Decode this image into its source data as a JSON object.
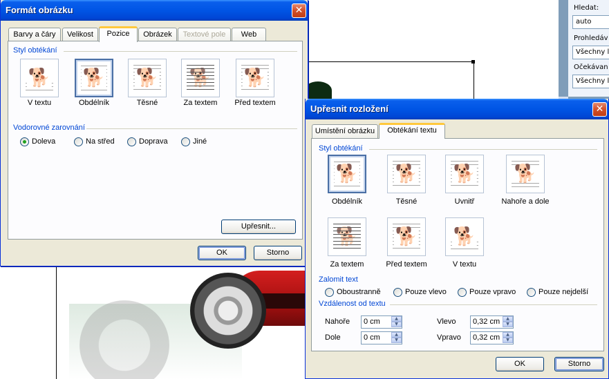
{
  "task_pane": {
    "search_label": "Hledat:",
    "search_value": "auto",
    "search_in_label": "Prohledáv",
    "search_in_value": "Všechny l",
    "expected_label": "Očekávan",
    "expected_value": "Všechny l"
  },
  "format_dialog": {
    "title": "Formát obrázku",
    "tabs": [
      {
        "label": "Barvy a čáry",
        "state": "normal"
      },
      {
        "label": "Velikost",
        "state": "normal"
      },
      {
        "label": "Pozice",
        "state": "active"
      },
      {
        "label": "Obrázek",
        "state": "normal"
      },
      {
        "label": "Textové pole",
        "state": "disabled"
      },
      {
        "label": "Web",
        "state": "normal"
      }
    ],
    "wrap_group_label": "Styl obtékání",
    "wrap_options": [
      {
        "label": "V textu",
        "icon": "inline-icon",
        "selected": false
      },
      {
        "label": "Obdélník",
        "icon": "square-wrap-icon",
        "selected": true
      },
      {
        "label": "Těsné",
        "icon": "tight-wrap-icon",
        "selected": false
      },
      {
        "label": "Za textem",
        "icon": "behind-text-icon",
        "selected": false
      },
      {
        "label": "Před textem",
        "icon": "in-front-text-icon",
        "selected": false
      }
    ],
    "align_group_label": "Vodorovné zarovnání",
    "align_options": [
      {
        "label": "Doleva",
        "checked": true
      },
      {
        "label": "Na střed",
        "checked": false
      },
      {
        "label": "Doprava",
        "checked": false
      },
      {
        "label": "Jiné",
        "checked": false
      }
    ],
    "advanced_button": "Upřesnit...",
    "ok_button": "OK",
    "cancel_button": "Storno"
  },
  "advanced_dialog": {
    "title": "Upřesnit rozložení",
    "tabs": [
      {
        "label": "Umístění obrázku",
        "state": "normal"
      },
      {
        "label": "Obtékání textu",
        "state": "active"
      }
    ],
    "wrap_group_label": "Styl obtékání",
    "wrap_options": [
      {
        "label": "Obdélník",
        "icon": "square-wrap-icon",
        "selected": true
      },
      {
        "label": "Těsné",
        "icon": "tight-wrap-icon",
        "selected": false
      },
      {
        "label": "Uvnitř",
        "icon": "through-wrap-icon",
        "selected": false
      },
      {
        "label": "Nahoře a dole",
        "icon": "top-bottom-icon",
        "selected": false
      },
      {
        "label": "Za textem",
        "icon": "behind-text-icon",
        "selected": false
      },
      {
        "label": "Před textem",
        "icon": "in-front-text-icon",
        "selected": false
      },
      {
        "label": "V textu",
        "icon": "inline-icon",
        "selected": false
      }
    ],
    "wrap_text_group_label": "Zalomit text",
    "wrap_text_options": [
      {
        "label": "Oboustranně",
        "checked": false
      },
      {
        "label": "Pouze vlevo",
        "checked": false
      },
      {
        "label": "Pouze vpravo",
        "checked": false
      },
      {
        "label": "Pouze nejdelší",
        "checked": false
      }
    ],
    "distance_group_label": "Vzdálenost od textu",
    "distance": {
      "top_label": "Nahoře",
      "top_value": "0 cm",
      "bottom_label": "Dole",
      "bottom_value": "0 cm",
      "left_label": "Vlevo",
      "left_value": "0,32 cm",
      "right_label": "Vpravo",
      "right_value": "0,32 cm"
    },
    "ok_button": "OK",
    "cancel_button": "Storno"
  }
}
